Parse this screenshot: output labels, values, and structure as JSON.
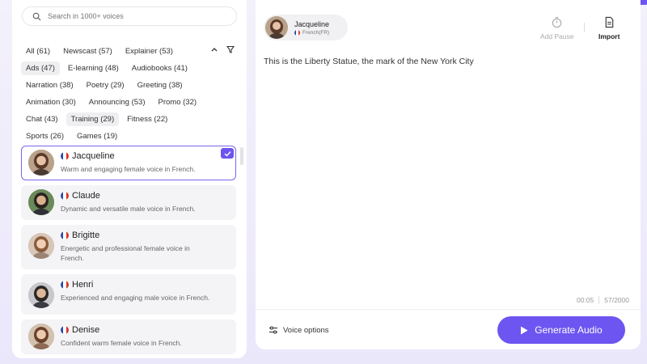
{
  "colors": {
    "accent": "#6c55f0",
    "selected_border": "#7a66e8"
  },
  "search": {
    "placeholder": "Search in 1000+ voices"
  },
  "filters": [
    [
      "All (61)",
      "Newscast (57)",
      "Explainer (53)"
    ],
    [
      "Ads (47)",
      "E-learning (48)",
      "Audiobooks (41)"
    ],
    [
      "Narration (38)",
      "Poetry (29)",
      "Greeting (38)"
    ],
    [
      "Animation (30)",
      "Announcing (53)",
      "Promo (32)"
    ],
    [
      "Chat (43)",
      "Training (29)",
      "Fitness (22)"
    ],
    [
      "Sports (26)",
      "Games (19)"
    ]
  ],
  "active_filters": [
    "Ads (47)",
    "Training (29)"
  ],
  "voices": [
    {
      "name": "Jacqueline",
      "desc": "Warm and engaging female voice in French.",
      "selected": true
    },
    {
      "name": "Claude",
      "desc": "Dynamic and versatile male voice in French.",
      "selected": false
    },
    {
      "name": "Brigitte",
      "desc": "Energetic and professional female voice in French.",
      "selected": false
    },
    {
      "name": "Henri",
      "desc": "Experienced and engaging male voice in French.",
      "selected": false
    },
    {
      "name": "Denise",
      "desc": "Confident warm female voice in French.",
      "selected": false
    }
  ],
  "current_voice": {
    "name": "Jacqueline",
    "lang": "French(FR)"
  },
  "toolbar": {
    "add_pause": "Add Pause",
    "import": "Import"
  },
  "script": {
    "text": "This is the Liberty Statue, the mark of the New York City"
  },
  "counter": {
    "time": "00:05",
    "chars": "57/2000"
  },
  "footer": {
    "voice_options": "Voice options",
    "generate": "Generate Audio"
  }
}
